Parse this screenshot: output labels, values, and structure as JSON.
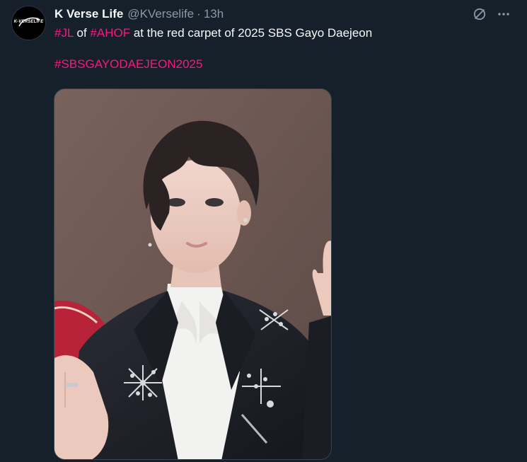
{
  "account": {
    "display_name": "K Verse Life",
    "handle": "@KVerselife",
    "separator": "·",
    "time": "13h",
    "avatar_text": "K-VERSELIFE"
  },
  "tweet": {
    "line1": {
      "hashtag1": "#JL",
      "text1": " of ",
      "hashtag2": "#AHOF",
      "text2": " at the red carpet of 2025 SBS Gayo Daejeon"
    },
    "hashtag3": "#SBSGAYODAEJEON2025"
  },
  "icons": {
    "grok": "grok-icon",
    "more": "more-icon"
  },
  "colors": {
    "background": "#15202b",
    "text": "#f7f9f9",
    "secondary": "#8b98a5",
    "hashtag": "#f91880"
  }
}
